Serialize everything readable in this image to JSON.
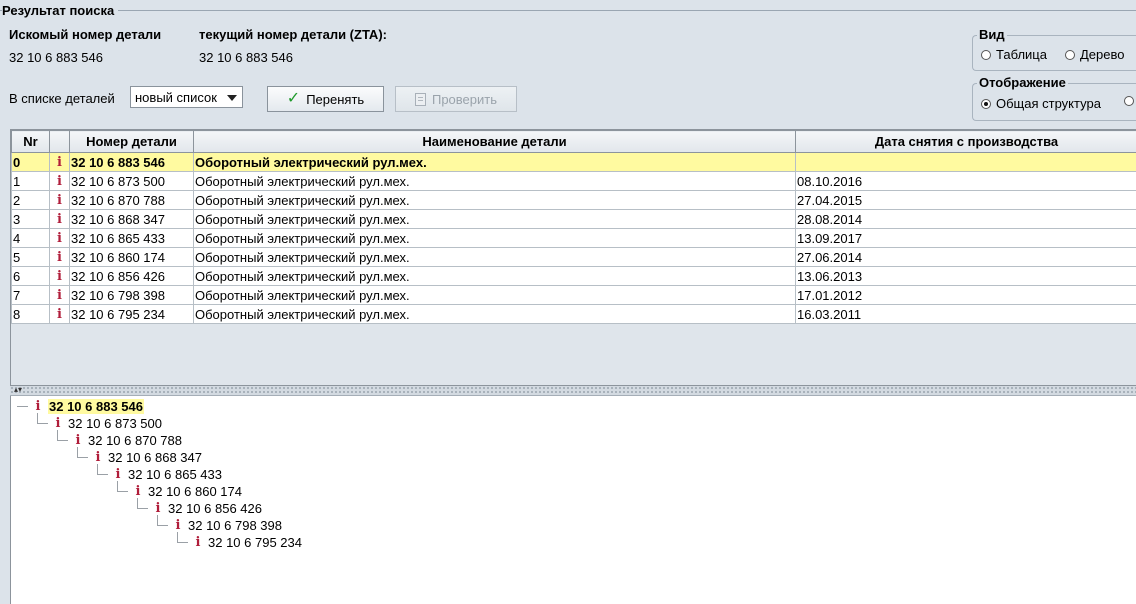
{
  "panel": {
    "title": "Результат поиска"
  },
  "header": {
    "searched_label": "Искомый номер детали",
    "searched_value": "32 10 6 883 546",
    "current_label": "текущий номер детали (ZTA):",
    "current_value": "32 10 6 883 546"
  },
  "list_controls": {
    "label": "В списке деталей",
    "selected_option": "новый список",
    "adopt_button": "Перенять",
    "verify_button": "Проверить"
  },
  "view_group": {
    "title": "Вид",
    "options": [
      "Таблица",
      "Дерево"
    ]
  },
  "display_group": {
    "title": "Отображение",
    "options": [
      "Общая структура"
    ]
  },
  "table": {
    "columns": [
      "Nr",
      "",
      "Номер детали",
      "Наименование детали",
      "Дата снятия с производства"
    ],
    "rows": [
      {
        "nr": "0",
        "part": "32 10 6 883 546",
        "name": "Оборотный электрический рул.мех.",
        "date": ""
      },
      {
        "nr": "1",
        "part": "32 10 6 873 500",
        "name": "Оборотный электрический рул.мех.",
        "date": "08.10.2016"
      },
      {
        "nr": "2",
        "part": "32 10 6 870 788",
        "name": "Оборотный электрический рул.мех.",
        "date": "27.04.2015"
      },
      {
        "nr": "3",
        "part": "32 10 6 868 347",
        "name": "Оборотный электрический рул.мех.",
        "date": "28.08.2014"
      },
      {
        "nr": "4",
        "part": "32 10 6 865 433",
        "name": "Оборотный электрический рул.мех.",
        "date": "13.09.2017"
      },
      {
        "nr": "5",
        "part": "32 10 6 860 174",
        "name": "Оборотный электрический рул.мех.",
        "date": "27.06.2014"
      },
      {
        "nr": "6",
        "part": "32 10 6 856 426",
        "name": "Оборотный электрический рул.мех.",
        "date": "13.06.2013"
      },
      {
        "nr": "7",
        "part": "32 10 6 798 398",
        "name": "Оборотный электрический рул.мех.",
        "date": "17.01.2012"
      },
      {
        "nr": "8",
        "part": "32 10 6 795 234",
        "name": "Оборотный электрический рул.мех.",
        "date": "16.03.2011"
      }
    ]
  },
  "tree": {
    "nodes": [
      "32 10 6 883 546",
      "32 10 6 873 500",
      "32 10 6 870 788",
      "32 10 6 868 347",
      "32 10 6 865 433",
      "32 10 6 860 174",
      "32 10 6 856 426",
      "32 10 6 798 398",
      "32 10 6 795 234"
    ]
  },
  "icons": {
    "info": "i",
    "check": "✓"
  },
  "colors": {
    "selection": "#fffaa0",
    "info_icon": "#b01d3a",
    "check": "#1f9a2b"
  }
}
